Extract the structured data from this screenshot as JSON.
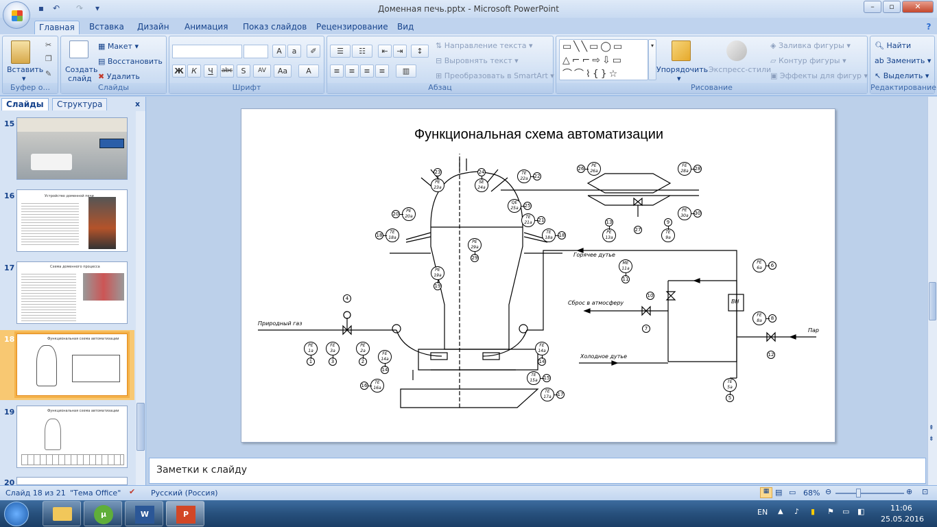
{
  "window": {
    "title": "Доменная печь.pptx - Microsoft PowerPoint"
  },
  "tabs": [
    "Главная",
    "Вставка",
    "Дизайн",
    "Анимация",
    "Показ слайдов",
    "Рецензирование",
    "Вид"
  ],
  "ribbon": {
    "clipboard": {
      "paste": "Вставить",
      "label": "Буфер о..."
    },
    "slides": {
      "new_slide_1": "Создать",
      "new_slide_2": "слайд",
      "layout": "Макет",
      "reset": "Восстановить",
      "delete": "Удалить",
      "label": "Слайды"
    },
    "font": {
      "label": "Шрифт",
      "bold": "Ж",
      "italic": "К",
      "underline": "Ч",
      "strike": "abc",
      "shadow": "S",
      "spacing": "AV",
      "case": "Aa",
      "color": "A"
    },
    "paragraph": {
      "direction": "Направление текста",
      "align": "Выровнять текст",
      "smartart": "Преобразовать в SmartArt",
      "label": "Абзац"
    },
    "drawing": {
      "arrange": "Упорядочить",
      "styles": "Экспресс-стили",
      "fill": "Заливка фигуры",
      "outline": "Контур фигуры",
      "effects": "Эффекты для фигур",
      "label": "Рисование"
    },
    "editing": {
      "find": "Найти",
      "replace": "Заменить",
      "select": "Выделить",
      "label": "Редактирование"
    }
  },
  "panel": {
    "tab_slides": "Слайды",
    "tab_outline": "Структура",
    "close": "x"
  },
  "thumbnails": [
    {
      "num": "15",
      "title": ""
    },
    {
      "num": "16",
      "title": "Устройство доменной печи"
    },
    {
      "num": "17",
      "title": "Схема доменного процесса"
    },
    {
      "num": "18",
      "title": "Функциональная схема автоматизации"
    },
    {
      "num": "19",
      "title": "Функциональная схема автоматизации"
    },
    {
      "num": "20",
      "title": ""
    }
  ],
  "slide": {
    "title": "Функциональная схема автоматизации",
    "labels": {
      "natural_gas": "Природный газ",
      "hot_blast": "Горячее дутье",
      "vent": "Сброс в атмосферу",
      "cold_blast": "Холодное дутье",
      "steam": "Пар",
      "vn": "ВН"
    },
    "instruments": [
      {
        "t": "PE",
        "s": "1a",
        "n": "1"
      },
      {
        "t": "FE",
        "s": "3a",
        "n": "3"
      },
      {
        "t": "PE",
        "s": "2a",
        "n": "2"
      },
      {
        "t": "FE",
        "s": "14a",
        "n": "14"
      },
      {
        "t": "FE",
        "s": "14a",
        "n": "14"
      },
      {
        "t": "TE",
        "s": "16a",
        "n": "16"
      },
      {
        "t": "TE",
        "s": "15a",
        "n": "15"
      },
      {
        "t": "TE",
        "s": "17a",
        "n": "17"
      },
      {
        "t": "PE",
        "s": "23a",
        "n": "23"
      },
      {
        "t": "SE",
        "s": "24a",
        "n": "24"
      },
      {
        "t": "TE",
        "s": "22a",
        "n": "22"
      },
      {
        "t": "PE",
        "s": "20a",
        "n": "20"
      },
      {
        "t": "QE",
        "s": "25a",
        "n": "25"
      },
      {
        "t": "TE",
        "s": "21a",
        "n": "21"
      },
      {
        "t": "TE",
        "s": "18a",
        "n": "18"
      },
      {
        "t": "TE",
        "s": "18a",
        "n": "18"
      },
      {
        "t": "PE",
        "s": "29a",
        "n": "29"
      },
      {
        "t": "PE",
        "s": "19a",
        "n": "19"
      },
      {
        "t": "PE",
        "s": "26a",
        "n": "26"
      },
      {
        "t": "FE",
        "s": "28a",
        "n": "28"
      },
      {
        "t": "PE",
        "s": "30a",
        "n": "30"
      },
      {
        "t": "PE",
        "s": "13a",
        "n": "13"
      },
      {
        "t": "TE",
        "s": "9a",
        "n": "9"
      },
      {
        "t": "ME",
        "s": "11a",
        "n": "11"
      },
      {
        "t": "PE",
        "s": "6a",
        "n": "6"
      },
      {
        "t": "FE",
        "s": "8a",
        "n": "8"
      },
      {
        "t": "TE",
        "s": "5a",
        "n": "5"
      }
    ],
    "valve_tags": [
      "4",
      "10",
      "7",
      "12",
      "27"
    ]
  },
  "notes": {
    "placeholder": "Заметки к слайду"
  },
  "status": {
    "slide": "Слайд 18 из 21",
    "theme": "\"Тема Office\"",
    "lang": "Русский (Россия)",
    "zoom": "68%"
  },
  "taskbar": {
    "lang": "EN",
    "time": "11:06",
    "date": "25.05.2016"
  }
}
